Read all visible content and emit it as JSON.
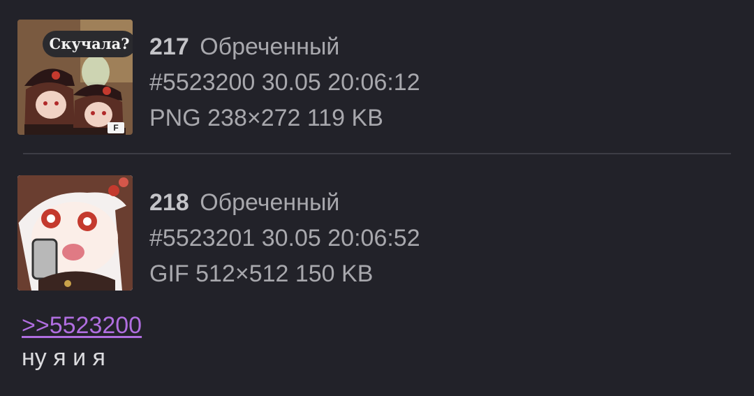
{
  "posts": [
    {
      "number": "217",
      "name": "Обреченный",
      "id": "#5523200",
      "datetime": "30.05 20:06:12",
      "file_info": "PNG 238×272 119 KB",
      "thumbnail": {
        "caption": "Скучала?",
        "badge": "F"
      }
    },
    {
      "number": "218",
      "name": "Обреченный",
      "id": "#5523201",
      "datetime": "30.05 20:06:52",
      "file_info": "GIF 512×512 150 KB",
      "reply_link": ">>5523200",
      "comment": "ну я и я"
    }
  ],
  "colors": {
    "background": "#222229",
    "meta_text": "#a8a8ad",
    "link": "#b06ee0",
    "comment_text": "#dcdcdf",
    "divider": "#3d3d45"
  }
}
